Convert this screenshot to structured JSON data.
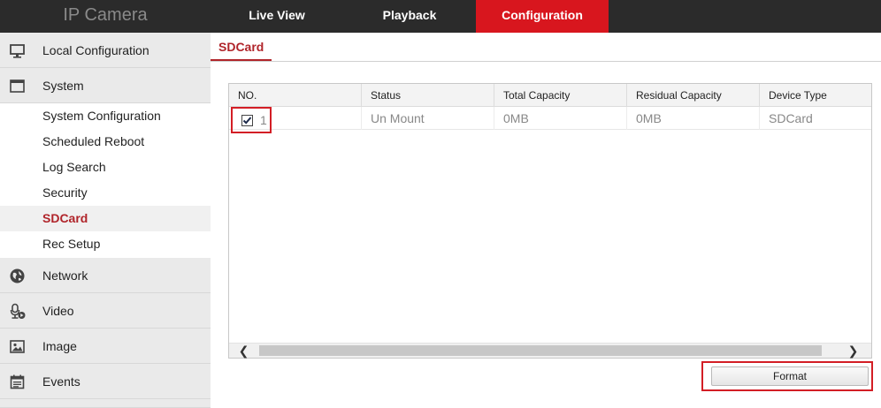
{
  "app": {
    "title": "IP Camera"
  },
  "nav": {
    "tabs": [
      {
        "label": "Live View"
      },
      {
        "label": "Playback"
      },
      {
        "label": "Configuration"
      }
    ],
    "active": "Configuration"
  },
  "sidebar": {
    "groups": [
      {
        "label": "Local Configuration",
        "icon": "monitor-icon"
      },
      {
        "label": "System",
        "icon": "window-icon"
      },
      {
        "label": "Network",
        "icon": "globe-icon"
      },
      {
        "label": "Video",
        "icon": "microphone-icon"
      },
      {
        "label": "Image",
        "icon": "image-icon"
      },
      {
        "label": "Events",
        "icon": "calendar-icon"
      }
    ],
    "system_items": [
      {
        "label": "System Configuration"
      },
      {
        "label": "Scheduled Reboot"
      },
      {
        "label": "Log Search"
      },
      {
        "label": "Security"
      },
      {
        "label": "SDCard"
      },
      {
        "label": "Rec Setup"
      }
    ],
    "active_item": "SDCard"
  },
  "page": {
    "tab": "SDCard"
  },
  "table": {
    "columns": [
      "NO.",
      "Status",
      "Total Capacity",
      "Residual Capacity",
      "Device Type"
    ],
    "rows": [
      {
        "no": "1",
        "status": "Un Mount",
        "total": "0MB",
        "residual": "0MB",
        "type": "SDCard",
        "checked": true
      }
    ]
  },
  "actions": {
    "format_label": "Format"
  },
  "colors": {
    "accent": "#d8161e",
    "topbar": "#2b2b2b",
    "active_text": "#b0242a"
  }
}
